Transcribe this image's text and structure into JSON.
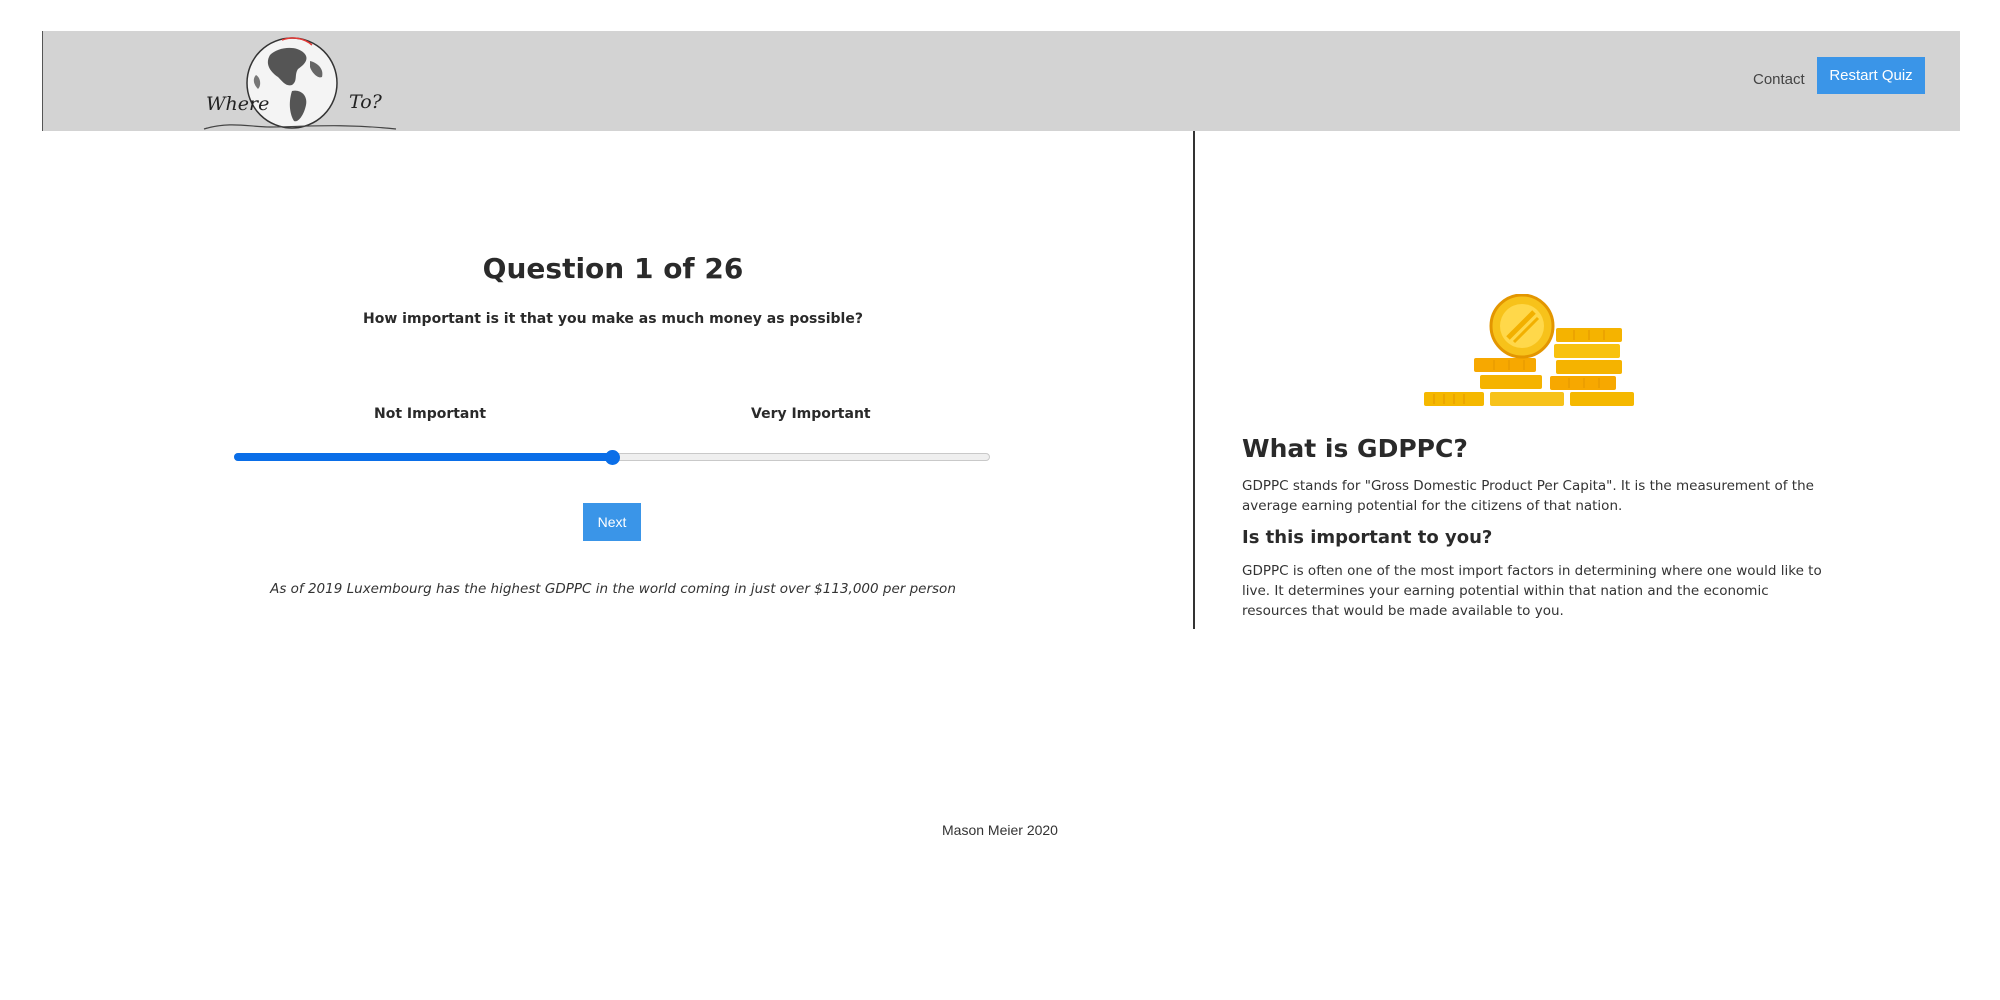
{
  "header": {
    "logo_where": "Where",
    "logo_to": "To?",
    "contact_label": "Contact",
    "restart_label": "Restart Quiz",
    "accent_color": "#3a95e8"
  },
  "quiz": {
    "question_title": "Question 1 of 26",
    "question_text": "How important is it that you make as much money as possible?",
    "scale_min_label": "Not Important",
    "scale_max_label": "Very Important",
    "slider_value": 0.5,
    "next_label": "Next",
    "fact": "As of 2019 Luxembourg has the highest GDPPC in the world coming in just over $113,000 per person"
  },
  "info": {
    "image_icon": "gold-coins-stack",
    "title": "What is GDPPC?",
    "definition": "GDPPC stands for \"Gross Domestic Product Per Capita\". It is the measurement of the average earning potential for the citizens of that nation.",
    "subtitle": "Is this important to you?",
    "importance": "GDPPC is often one of the most import factors in determining where one would like to live. It determines your earning potential within that nation and the economic resources that would be made available to you."
  },
  "footer": {
    "credit": "Mason Meier 2020"
  }
}
